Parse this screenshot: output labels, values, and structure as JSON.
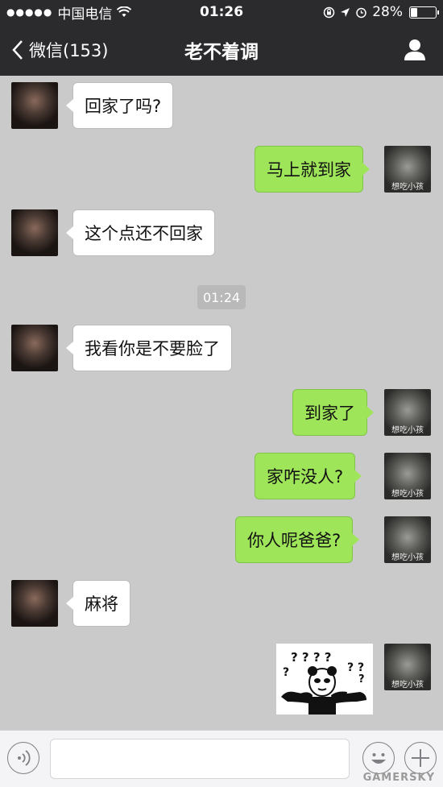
{
  "status_bar": {
    "signal": "●●●●●",
    "carrier": "中国电信",
    "time": "01:26",
    "battery_percent": "28%",
    "battery_level": 0.28
  },
  "nav": {
    "back_label": "微信(153)",
    "title": "老不着调"
  },
  "avatars": {
    "me_caption": "想吃小孩"
  },
  "messages": [
    {
      "side": "in",
      "text": "回家了吗?"
    },
    {
      "side": "out",
      "text": "马上就到家"
    },
    {
      "side": "in",
      "text": "这个点还不回家"
    },
    {
      "side": "in",
      "text": "我看你是不要脸了"
    },
    {
      "side": "out",
      "text": "到家了"
    },
    {
      "side": "out",
      "text": "家咋没人?"
    },
    {
      "side": "out",
      "text": "你人呢爸爸?"
    },
    {
      "side": "in",
      "text": "麻将"
    }
  ],
  "timestamp": "01:24",
  "sticker": {
    "marks": "? ? ? ? ? ? ? ? ?"
  },
  "input_bar": {
    "placeholder": ""
  },
  "watermark": "GAMERSKY",
  "colors": {
    "nav_bg": "#2b2b2e",
    "chat_bg": "#cacaca",
    "bubble_out": "#9fe55a",
    "bubble_in": "#ffffff"
  }
}
